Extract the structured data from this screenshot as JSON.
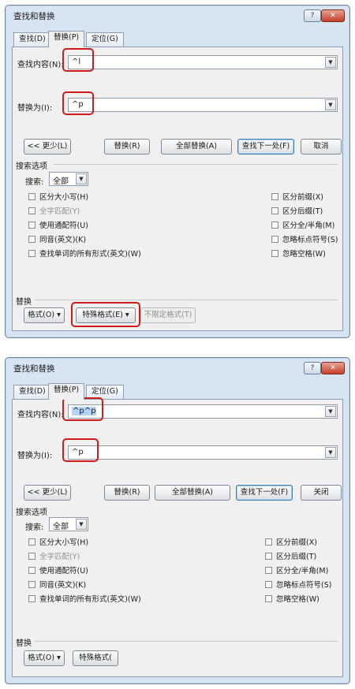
{
  "dialog_title": "查找和替换",
  "title_buttons": {
    "help": "?",
    "close": "✕"
  },
  "tabs": [
    "查找(D)",
    "替换(P)",
    "定位(G)"
  ],
  "labels": {
    "find_what": "查找内容(N):",
    "replace_with": "替换为(I):",
    "search_options": "搜索选项",
    "search": "搜索:",
    "replace_section": "替换"
  },
  "search_direction": "全部",
  "left_options": [
    "区分大小写(H)",
    "全字匹配(Y)",
    "使用通配符(U)",
    "同音(英文)(K)",
    "查找单词的所有形式(英文)(W)"
  ],
  "right_options": [
    "区分前缀(X)",
    "区分后缀(T)",
    "区分全/半角(M)",
    "忽略标点符号(S)",
    "忽略空格(W)"
  ],
  "buttons": {
    "less": "<< 更少(L)",
    "replace": "替换(R)",
    "replace_all": "全部替换(A)",
    "find_next": "查找下一处(F)",
    "format": "格式(O) ▾",
    "special": "特殊格式(E) ▾",
    "no_format": "不限定格式(T)"
  },
  "dialog1": {
    "find_value": "^l",
    "replace_value": "^p",
    "cancel": "取消"
  },
  "dialog2": {
    "find_value": "^p^p",
    "replace_value": "^p",
    "close": "关闭",
    "special_truncated": "特殊格式("
  },
  "colors": {
    "highlight_box": "#d11a1a",
    "window_frame": "#d7e4f2",
    "selection": "#b3d4f7"
  }
}
